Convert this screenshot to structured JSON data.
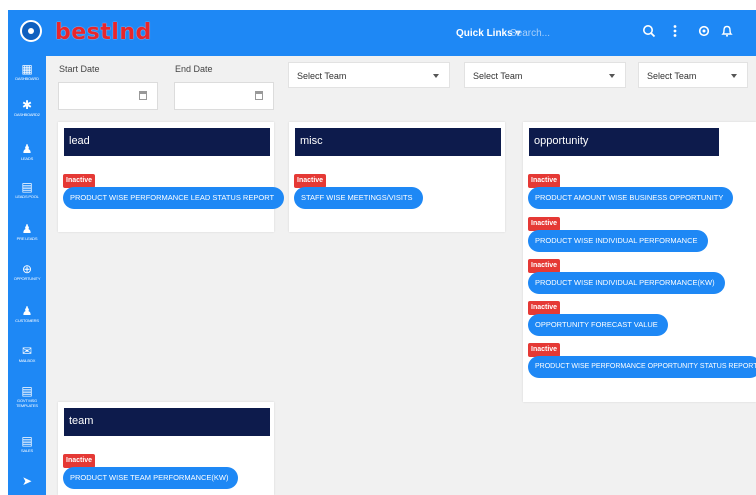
{
  "topbar": {
    "logo": "bestlnd",
    "quick_links": "Quick Links ▾",
    "search_placeholder": "Search..."
  },
  "sidebar": {
    "items": [
      {
        "label": "DASHBOARD",
        "icon": "dashboard-icon"
      },
      {
        "label": "DASHBOARD2",
        "icon": "puzzle-icon"
      },
      {
        "label": "LEADS",
        "icon": "users-icon"
      },
      {
        "label": "LEADS POOL",
        "icon": "trash-icon"
      },
      {
        "label": "PRE LEADS",
        "icon": "user-plus-icon"
      },
      {
        "label": "OPPORTUNITY",
        "icon": "target-icon"
      },
      {
        "label": "CUSTOMERS",
        "icon": "user-icon"
      },
      {
        "label": "MAILBOX",
        "icon": "mail-icon"
      },
      {
        "label": "GOVT MSG TEMPLATES",
        "icon": "file-icon"
      },
      {
        "label": "SALES",
        "icon": "document-icon"
      },
      {
        "label": "",
        "icon": "arrow-icon"
      }
    ]
  },
  "filters": {
    "start_date_label": "Start Date",
    "end_date_label": "End Date",
    "start_date_value": "",
    "end_date_value": "",
    "team_select_1": "Select Team",
    "team_select_2": "Select Team",
    "team_select_3": "Select Team"
  },
  "cards": {
    "lead": {
      "title": "lead",
      "reports": [
        {
          "status": "Inactive",
          "name": "PRODUCT WISE PERFORMANCE LEAD STATUS REPORT"
        }
      ]
    },
    "misc": {
      "title": "misc",
      "reports": [
        {
          "status": "Inactive",
          "name": "STAFF WISE MEETINGS/VISITS"
        }
      ]
    },
    "opportunity": {
      "title": "opportunity",
      "reports": [
        {
          "status": "Inactive",
          "name": "PRODUCT AMOUNT WISE BUSINESS OPPORTUNITY"
        },
        {
          "status": "Inactive",
          "name": "PRODUCT WISE INDIVIDUAL PERFORMANCE"
        },
        {
          "status": "Inactive",
          "name": "PRODUCT WISE INDIVIDUAL PERFORMANCE(KW)"
        },
        {
          "status": "Inactive",
          "name": "OPPORTUNITY FORECAST VALUE"
        },
        {
          "status": "Inactive",
          "name": "PRODUCT WISE PERFORMANCE OPPORTUNITY STATUS REPORT"
        }
      ]
    },
    "team": {
      "title": "team",
      "reports": [
        {
          "status": "Inactive",
          "name": "PRODUCT WISE TEAM PERFORMANCE(KW)"
        }
      ]
    }
  },
  "colors": {
    "primary": "#1e88f5",
    "card_header": "#0d1b4c",
    "inactive_badge": "#e53935",
    "logo": "#e8262b"
  }
}
